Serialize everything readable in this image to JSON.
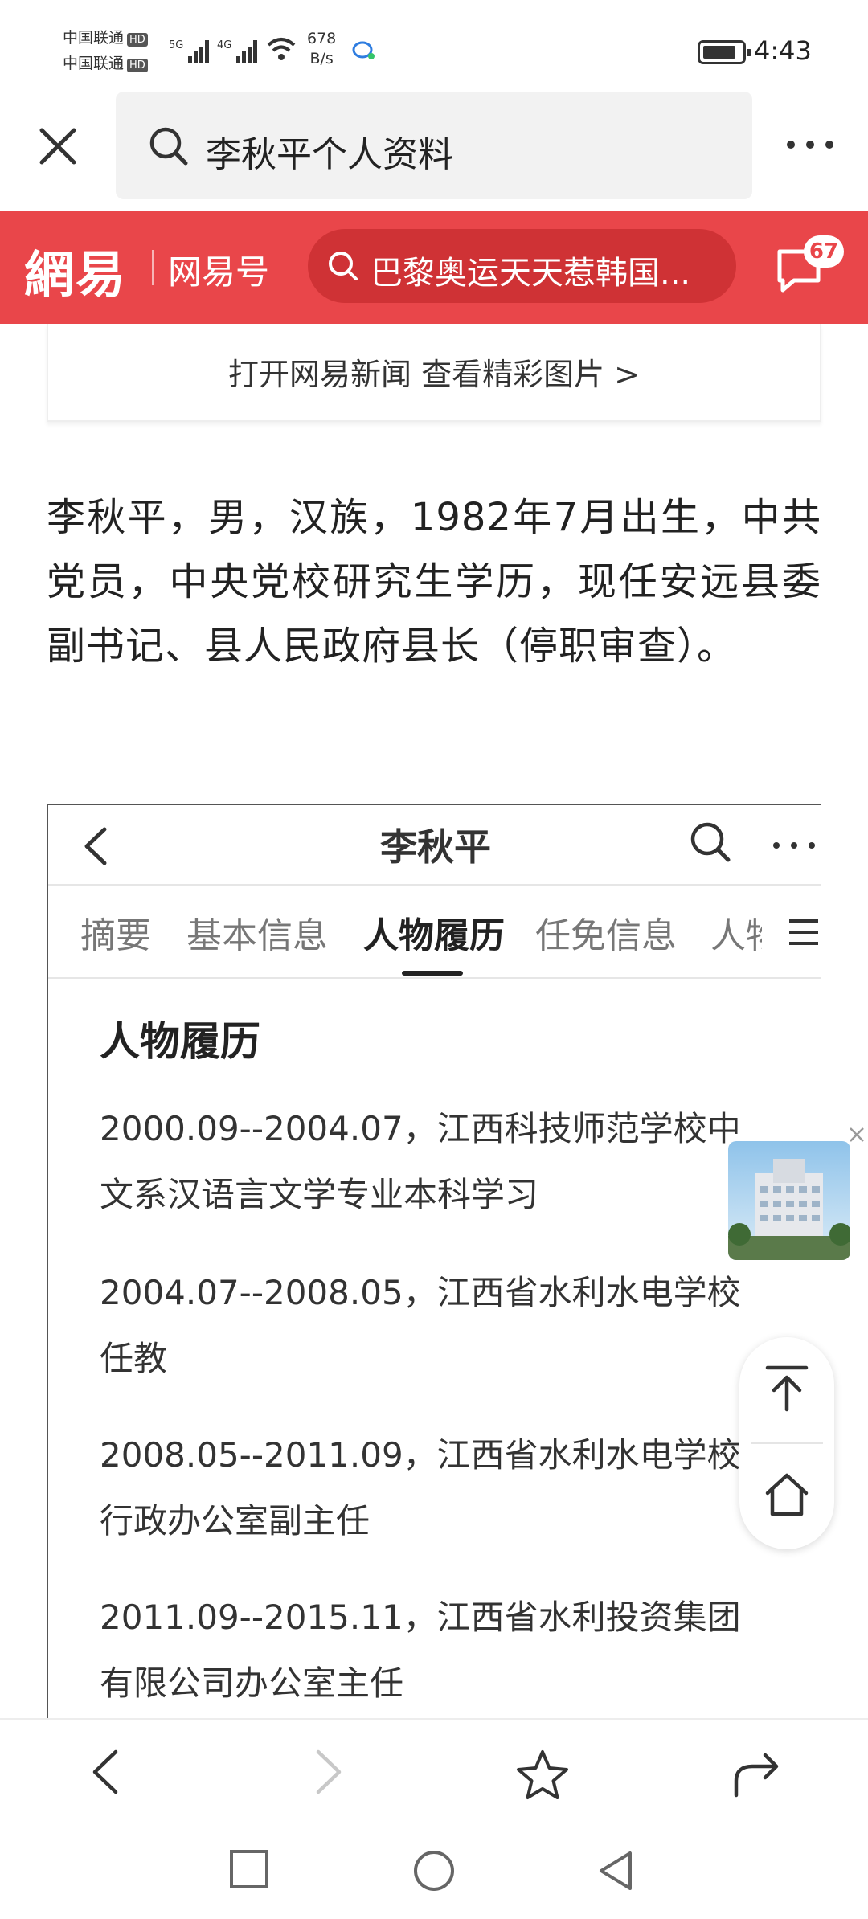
{
  "status_bar": {
    "carrier_1": "中国联通",
    "carrier_2": "中国联通",
    "hd": "HD",
    "net_1": "5G",
    "net_2": "4G",
    "speed_value": "678",
    "speed_unit": "B/s",
    "time": "4:43"
  },
  "browser": {
    "search_query": "李秋平个人资料"
  },
  "netease_header": {
    "logo": "網易",
    "channel_label": "网易号",
    "hot_search": "巴黎奥运天天惹韩国...",
    "message_count": "67"
  },
  "open_app_banner": "打开网易新闻 查看精彩图片 >",
  "article_text": "李秋平，男，汉族，1982年7月出生，中共党员，中央党校研究生学历，现任安远县委副书记、县人民政府县长（停职审查）。",
  "embedded_screenshot": {
    "title": "李秋平",
    "tabs": [
      "摘要",
      "基本信息",
      "人物履历",
      "任免信息",
      "人物"
    ],
    "active_tab": "人物履历",
    "section_title": "人物履历",
    "entries": [
      {
        "line1": "2000.09--2004.07，江西科技师范学校中",
        "line2": "文系汉语言文学专业本科学习"
      },
      {
        "line1": "2004.07--2008.05，江西省水利水电学校",
        "line2": "任教"
      },
      {
        "line1": "2008.05--2011.09，江西省水利水电学校",
        "line2": "行政办公室副主任"
      },
      {
        "line1": "2011.09--2015.11，江西省水利投资集团",
        "line2": "有限公司办公室主任"
      }
    ]
  },
  "colors": {
    "brand_red": "#e9464a",
    "hot_search_bg": "#cf3235"
  },
  "icons": [
    "close-icon",
    "search-icon",
    "more-icon",
    "message-icon",
    "back-icon",
    "forward-icon",
    "star-icon",
    "share-icon",
    "scroll-top-icon",
    "home-icon",
    "menu-icon",
    "square-icon",
    "circle-icon",
    "triangle-icon"
  ]
}
